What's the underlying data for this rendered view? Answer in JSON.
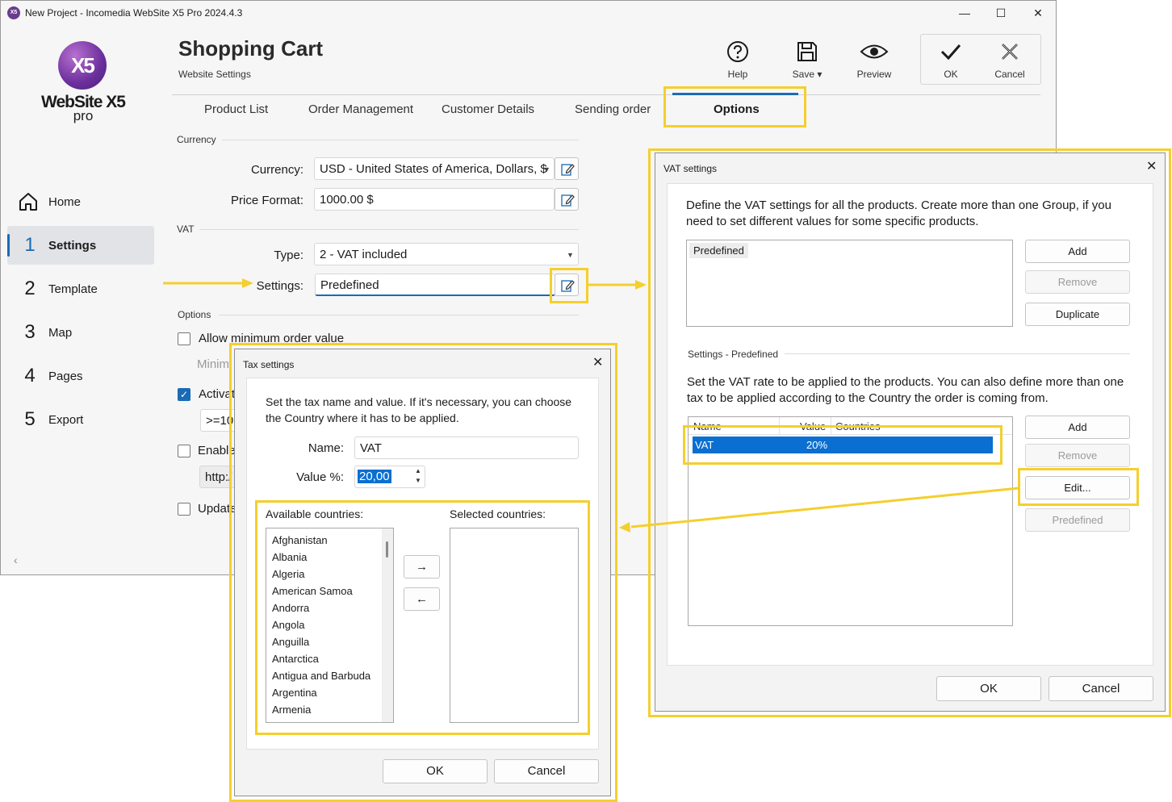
{
  "window": {
    "title": "New Project - Incomedia WebSite X5 Pro 2024.4.3",
    "app_icon": "X5",
    "min": "—",
    "max": "☐",
    "close": "✕"
  },
  "logo": {
    "mark": "X5",
    "name": "WebSite X5",
    "edition": "pro"
  },
  "sidebar": {
    "items": [
      {
        "num": "⌂",
        "label": "Home",
        "icon": "home-icon"
      },
      {
        "num": "1",
        "label": "Settings",
        "active": true
      },
      {
        "num": "2",
        "label": "Template"
      },
      {
        "num": "3",
        "label": "Map"
      },
      {
        "num": "4",
        "label": "Pages"
      },
      {
        "num": "5",
        "label": "Export"
      }
    ],
    "collapse": "‹"
  },
  "header": {
    "title": "Shopping Cart",
    "subtitle": "Website Settings",
    "toolbar": {
      "help": "Help",
      "save": "Save ▾",
      "preview": "Preview",
      "ok": "OK",
      "cancel": "Cancel"
    }
  },
  "tabs": [
    "Product List",
    "Order Management",
    "Customer Details",
    "Sending order",
    "Options"
  ],
  "active_tab": "Options",
  "form": {
    "currency_section": "Currency",
    "currency_label": "Currency:",
    "currency_value": "USD - United States of America, Dollars, $",
    "price_format_label": "Price Format:",
    "price_format_value": "1000.00 $",
    "vat_section": "VAT",
    "type_label": "Type:",
    "type_value": "2 - VAT included",
    "settings_label": "Settings:",
    "settings_value": "Predefined",
    "options_section": "Options",
    "opt_min_order": "Allow minimum order value",
    "opt_min_partial": "Minim",
    "opt_activate": "Activat",
    "opt_activate_value": ">=10",
    "opt_enable": "Enable",
    "opt_url_partial": "http:/",
    "opt_update": "Update"
  },
  "vat_dialog": {
    "title": "VAT settings",
    "close": "✕",
    "intro": "Define the VAT settings for all the products. Create more than one Group, if you need to set different values for some specific products.",
    "groups": [
      "Predefined"
    ],
    "add": "Add",
    "remove": "Remove",
    "duplicate": "Duplicate",
    "settings_section": "Settings - Predefined",
    "rate_text": "Set the VAT rate to be applied to the products. You can also define more than one tax to be applied according to the Country the order is coming from.",
    "columns": [
      "Name",
      "Value",
      "Countries"
    ],
    "rows": [
      {
        "name": "VAT",
        "value": "20%",
        "countries": ""
      }
    ],
    "add2": "Add",
    "remove2": "Remove",
    "edit": "Edit...",
    "predefined": "Predefined",
    "ok": "OK",
    "cancel": "Cancel"
  },
  "tax_dialog": {
    "title": "Tax settings",
    "close": "✕",
    "intro": "Set the tax name and value. If it's necessary, you can choose the Country where it has to be applied.",
    "name_label": "Name:",
    "name_value": "VAT",
    "value_label": "Value %:",
    "value_value": "20,00",
    "available_label": "Available countries:",
    "selected_label": "Selected countries:",
    "countries": [
      "Afghanistan",
      "Albania",
      "Algeria",
      "American Samoa",
      "Andorra",
      "Angola",
      "Anguilla",
      "Antarctica",
      "Antigua and Barbuda",
      "Argentina",
      "Armenia"
    ],
    "move_right": "→",
    "move_left": "←",
    "ok": "OK",
    "cancel": "Cancel"
  },
  "colors": {
    "accent": "#1a6bb5",
    "highlight": "#f4cf2d",
    "selection": "#0a6fd1"
  }
}
